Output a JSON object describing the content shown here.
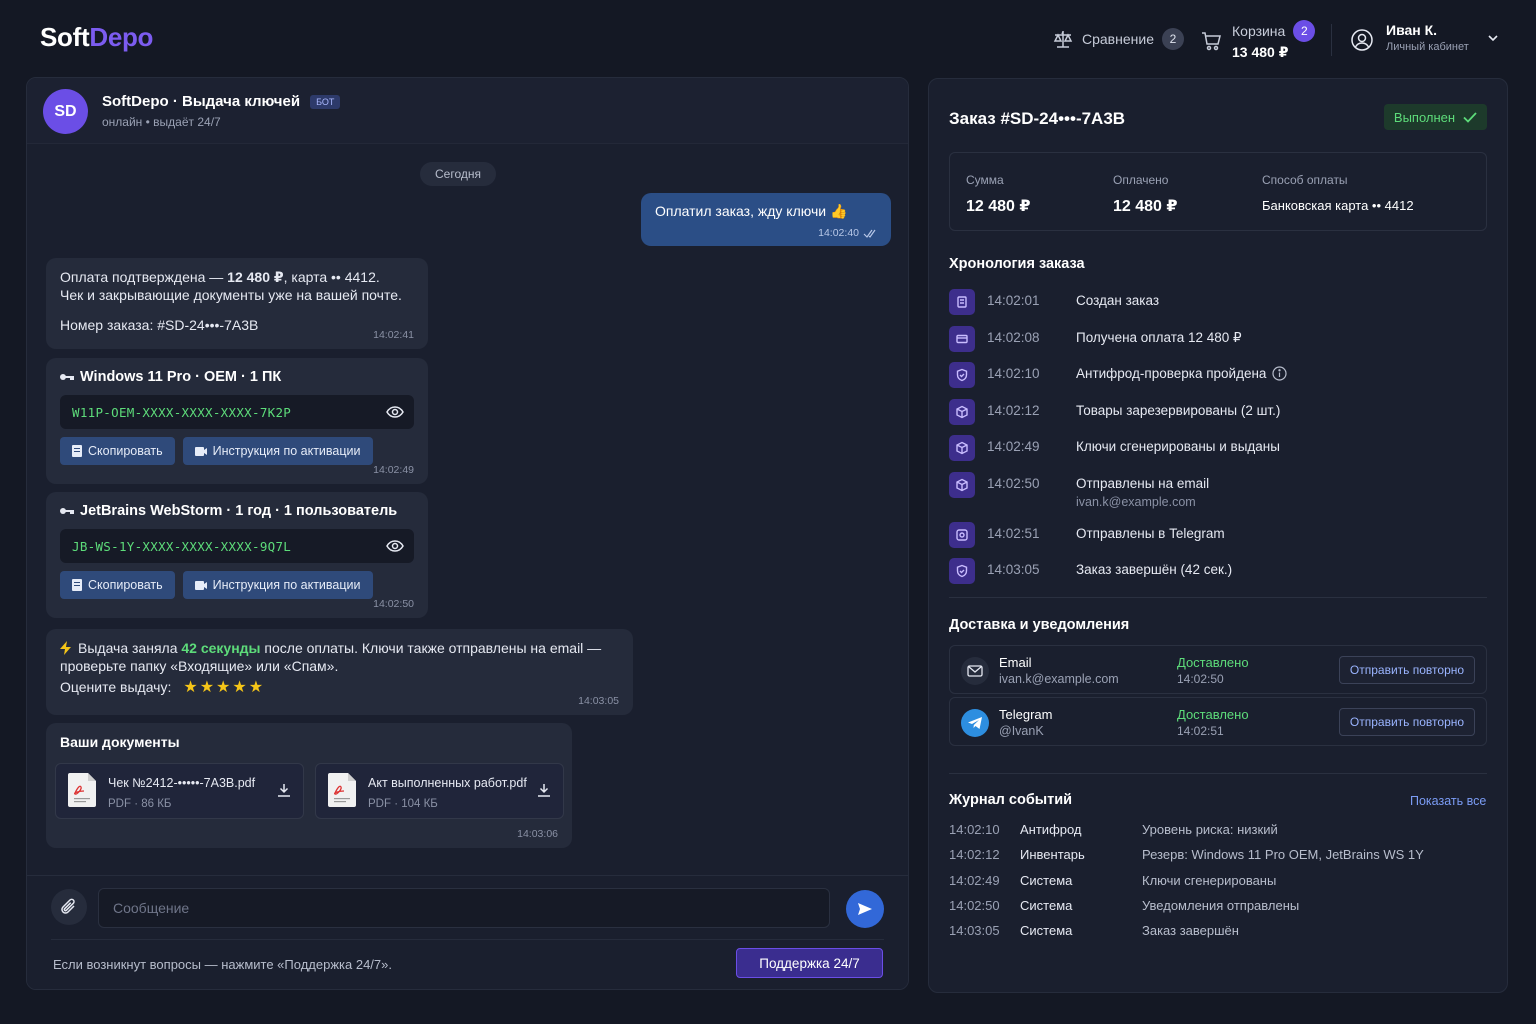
{
  "header": {
    "logo_part1": "Soft",
    "logo_part2": "Depo",
    "compare_label": "Сравнение",
    "compare_count": "2",
    "cart_label": "Корзина",
    "cart_count": "2",
    "cart_total": "13 480 ₽",
    "user_name": "Иван К.",
    "user_sub": "Личный кабинет"
  },
  "chat": {
    "avatar": "SD",
    "title": "SoftDepo · Выдача ключей",
    "bot_badge": "БОТ",
    "subtitle": "онлайн • выдаёт 24/7",
    "day": "Сегодня",
    "out_msg": "Оплатил заказ, жду ключи 👍",
    "out_time": "14:02:40",
    "confirm_a": "Оплата подтверждена — ",
    "confirm_b": "12 480 ₽",
    "confirm_c": ", карта •• 4412.",
    "confirm_line2": "Чек и закрывающие документы уже на вашей почте.",
    "confirm_line3": "Номер заказа: #SD-24•••-7A3B",
    "confirm_time": "14:02:41",
    "keys": [
      {
        "title": "Windows 11 Pro · OEM · 1 ПК",
        "code": "W11P-OEM-XXXX-XXXX-XXXX-7K2P",
        "time": "14:02:49"
      },
      {
        "title": "JetBrains WebStorm · 1 год · 1 пользователь",
        "code": "JB-WS-1Y-XXXX-XXXX-XXXX-9Q7L",
        "time": "14:02:50"
      }
    ],
    "copy_label": "Скопировать",
    "instr_label": "Инструкция по активации",
    "info_a": "Выдача заняла ",
    "info_b": "42 секунды",
    "info_c": " после оплаты. Ключи также отправлены на email —",
    "info_line2": "проверьте папку «Входящие» или «Спам».",
    "rate_label": "Оцените выдачу:",
    "rating": 5,
    "info_time": "14:03:05",
    "docs_title": "Ваши документы",
    "docs": [
      {
        "name": "Чек №2412-•••••-7A3B.pdf",
        "meta": "PDF · 86 КБ"
      },
      {
        "name": "Акт выполненных работ.pdf",
        "meta": "PDF · 104 КБ"
      }
    ],
    "docs_time": "14:03:06",
    "input_placeholder": "Сообщение",
    "hint": "Если возникнут вопросы — нажмите «Поддержка 24/7».",
    "support_label": "Поддержка 24/7"
  },
  "order": {
    "title": "Заказ #SD-24•••-7A3B",
    "status": "Выполнен",
    "sum_label": "Сумма",
    "sum_value": "12 480 ₽",
    "paid_label": "Оплачено",
    "paid_value": "12 480 ₽",
    "method_label": "Способ оплаты",
    "method_value": "Банковская карта •• 4412",
    "timeline_title": "Хронология заказа",
    "timeline": [
      {
        "time": "14:02:01",
        "event": "Создан заказ",
        "sub": ""
      },
      {
        "time": "14:02:08",
        "event": "Получена оплата 12 480 ₽",
        "sub": ""
      },
      {
        "time": "14:02:10",
        "event": "Антифрод-проверка пройдена",
        "sub": ""
      },
      {
        "time": "14:02:12",
        "event": "Товары зарезервированы (2 шт.)",
        "sub": ""
      },
      {
        "time": "14:02:49",
        "event": "Ключи сгенерированы и выданы",
        "sub": ""
      },
      {
        "time": "14:02:50",
        "event": "Отправлены на email",
        "sub": "ivan.k@example.com"
      },
      {
        "time": "14:02:51",
        "event": "Отправлены в Telegram",
        "sub": ""
      },
      {
        "time": "14:03:05",
        "event": "Заказ завершён (42 сек.)",
        "sub": ""
      }
    ],
    "delivery_title": "Доставка и уведомления",
    "delivery": [
      {
        "channel": "Email",
        "address": "ivan.k@example.com",
        "status": "Доставлено",
        "time": "14:02:50",
        "resend": "Отправить повторно"
      },
      {
        "channel": "Telegram",
        "address": "@IvanK",
        "status": "Доставлено",
        "time": "14:02:51",
        "resend": "Отправить повторно"
      }
    ],
    "log_title": "Журнал событий",
    "show_all": "Показать все",
    "log": [
      {
        "time": "14:02:10",
        "source": "Антифрод",
        "message": "Уровень риска: низкий"
      },
      {
        "time": "14:02:12",
        "source": "Инвентарь",
        "message": "Резерв: Windows 11 Pro OEM, JetBrains WS 1Y"
      },
      {
        "time": "14:02:49",
        "source": "Система",
        "message": "Ключи сгенерированы"
      },
      {
        "time": "14:02:50",
        "source": "Система",
        "message": "Уведомления отправлены"
      },
      {
        "time": "14:03:05",
        "source": "Система",
        "message": "Заказ завершён"
      }
    ]
  }
}
